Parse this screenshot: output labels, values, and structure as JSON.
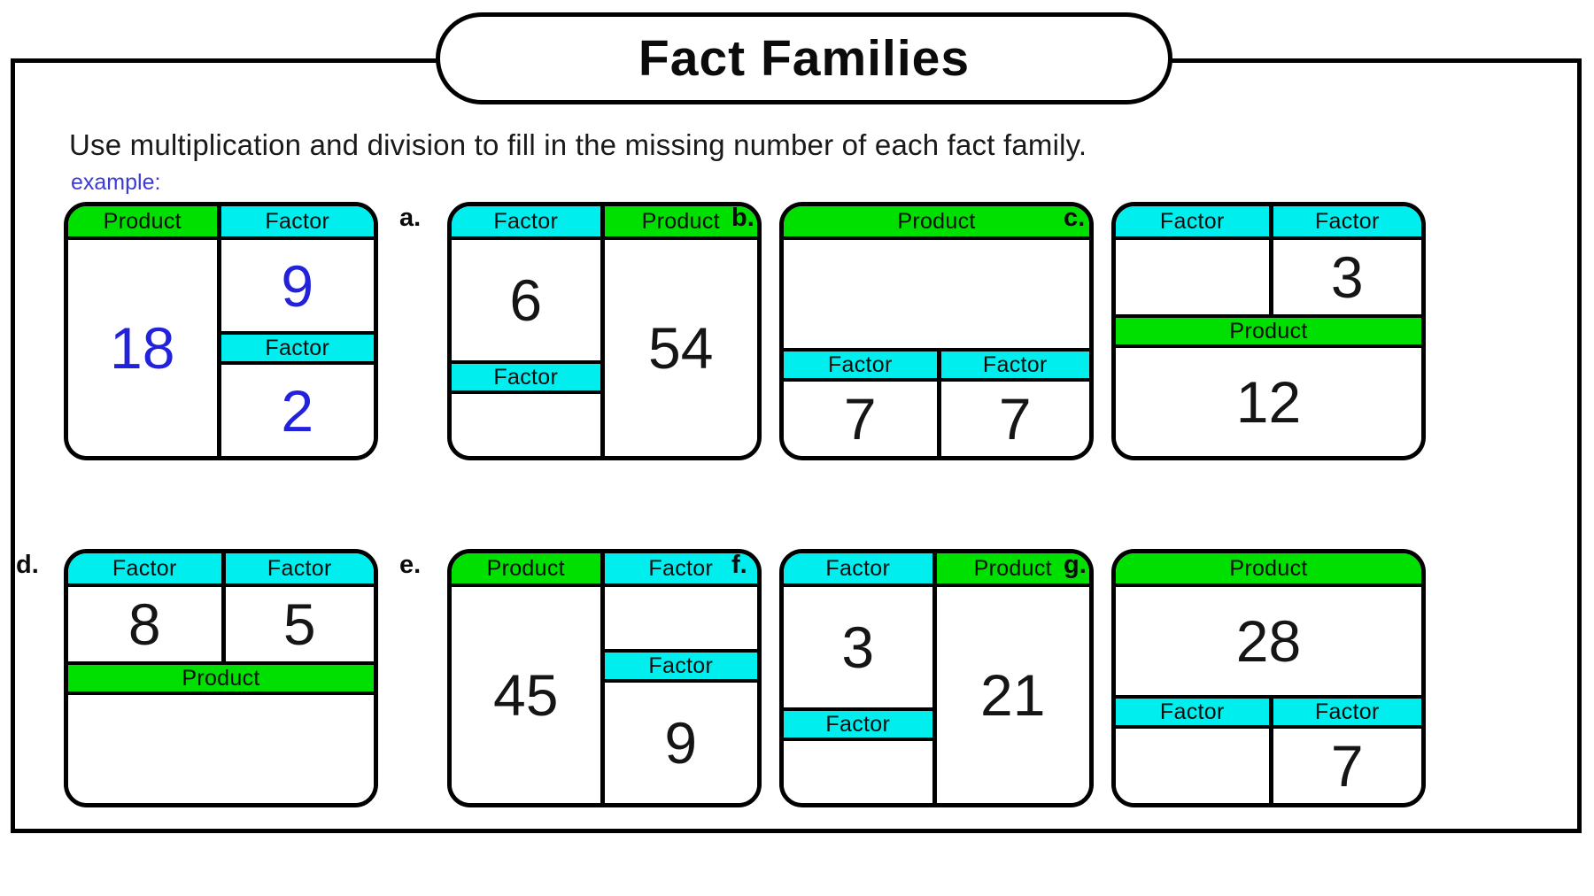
{
  "title": "Fact Families",
  "instruction": "Use multiplication and division to fill in the missing number of each fact family.",
  "example_label": "example:",
  "labels": {
    "product": "Product",
    "factor": "Factor"
  },
  "colors": {
    "product_header": "#00e000",
    "factor_header": "#00eeee",
    "example_ink": "#2222dd",
    "ink": "#151515",
    "border": "#000000"
  },
  "problems": [
    {
      "letter": "",
      "is_example": true,
      "orientation": "vertical",
      "left": {
        "header": "Product",
        "header_color": "product",
        "value": "18"
      },
      "right": [
        {
          "header": "Factor",
          "header_color": "factor",
          "value": "9"
        },
        {
          "header": "Factor",
          "header_color": "factor",
          "value": "2"
        }
      ]
    },
    {
      "letter": "a.",
      "is_example": false,
      "orientation": "vertical-left-split",
      "left": [
        {
          "header": "Factor",
          "header_color": "factor",
          "value": "6"
        },
        {
          "header": "Factor",
          "header_color": "factor",
          "value": ""
        }
      ],
      "right": {
        "header": "Product",
        "header_color": "product",
        "value": "54"
      }
    },
    {
      "letter": "b.",
      "is_example": false,
      "orientation": "horizontal-top-full",
      "top": {
        "header": "Product",
        "header_color": "product",
        "value": ""
      },
      "bottom": [
        {
          "header": "Factor",
          "header_color": "factor",
          "value": "7"
        },
        {
          "header": "Factor",
          "header_color": "factor",
          "value": "7"
        }
      ]
    },
    {
      "letter": "c.",
      "is_example": false,
      "orientation": "horizontal-bottom-full",
      "top": [
        {
          "header": "Factor",
          "header_color": "factor",
          "value": ""
        },
        {
          "header": "Factor",
          "header_color": "factor",
          "value": "3"
        }
      ],
      "bottom": {
        "header": "Product",
        "header_color": "product",
        "value": "12"
      }
    },
    {
      "letter": "d.",
      "is_example": false,
      "orientation": "horizontal-bottom-full",
      "top": [
        {
          "header": "Factor",
          "header_color": "factor",
          "value": "8"
        },
        {
          "header": "Factor",
          "header_color": "factor",
          "value": "5"
        }
      ],
      "bottom": {
        "header": "Product",
        "header_color": "product",
        "value": ""
      }
    },
    {
      "letter": "e.",
      "is_example": false,
      "orientation": "vertical",
      "left": {
        "header": "Product",
        "header_color": "product",
        "value": "45"
      },
      "right": [
        {
          "header": "Factor",
          "header_color": "factor",
          "value": ""
        },
        {
          "header": "Factor",
          "header_color": "factor",
          "value": "9"
        }
      ]
    },
    {
      "letter": "f.",
      "is_example": false,
      "orientation": "vertical-left-split",
      "left": [
        {
          "header": "Factor",
          "header_color": "factor",
          "value": "3"
        },
        {
          "header": "Factor",
          "header_color": "factor",
          "value": ""
        }
      ],
      "right": {
        "header": "Product",
        "header_color": "product",
        "value": "21"
      }
    },
    {
      "letter": "g.",
      "is_example": false,
      "orientation": "horizontal-top-full",
      "top": {
        "header": "Product",
        "header_color": "product",
        "value": "28"
      },
      "bottom": [
        {
          "header": "Factor",
          "header_color": "factor",
          "value": ""
        },
        {
          "header": "Factor",
          "header_color": "factor",
          "value": "7"
        }
      ]
    }
  ]
}
